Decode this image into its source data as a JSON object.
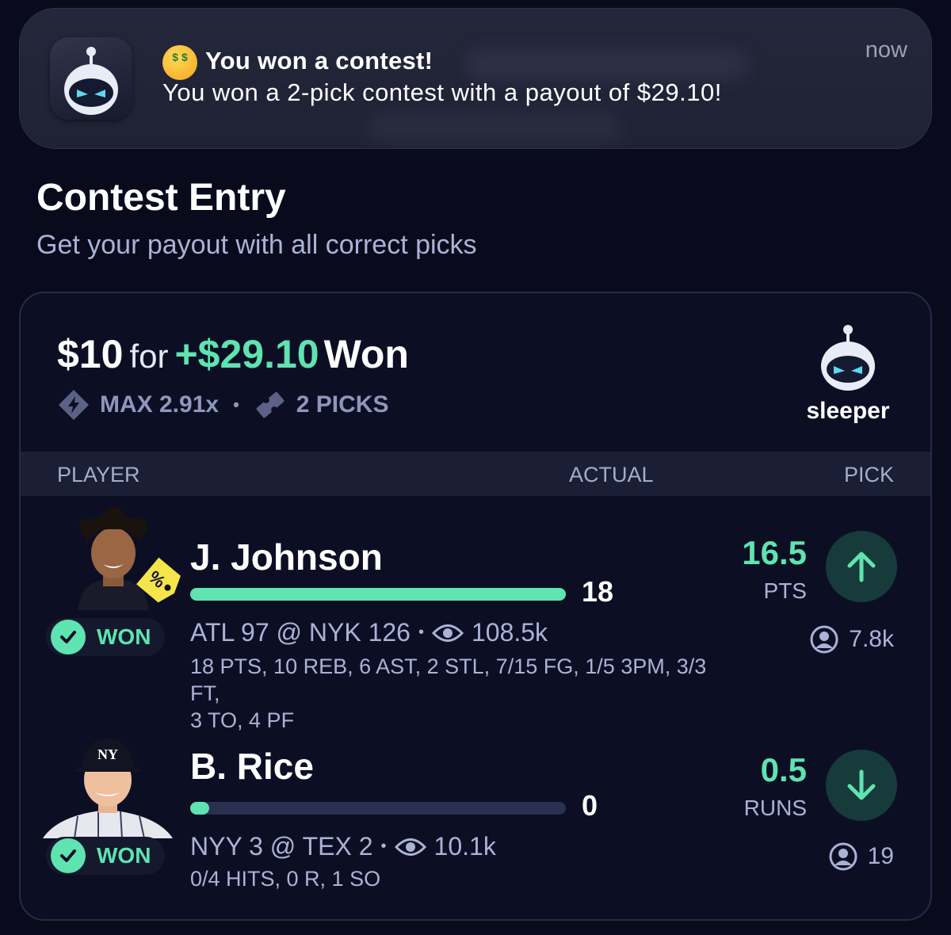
{
  "notification": {
    "title": "You won a contest!",
    "body": "You won a 2-pick contest with a payout of $29.10!",
    "time": "now"
  },
  "header": {
    "title": "Contest Entry",
    "subtitle": "Get your payout with all correct picks"
  },
  "entry": {
    "stake": "$10",
    "for_text": "for",
    "payout": "+$29.10",
    "result": "Won",
    "max_multiplier": "MAX 2.91x",
    "picks_count": "2 PICKS",
    "brand": "sleeper"
  },
  "table": {
    "columns": [
      "PLAYER",
      "ACTUAL",
      "PICK"
    ]
  },
  "picks": [
    {
      "player": "J. Johnson",
      "status": "WON",
      "actual": "18",
      "progress": 1.0,
      "game": "ATL 97 @ NYK 126",
      "watchers": "108.5k",
      "stats_line1": "18 PTS, 10 REB, 6 AST, 2 STL, 7/15 FG, 1/5 3PM, 3/3 FT,",
      "stats_line2": "3 TO, 4 PF",
      "line": "16.5",
      "unit": "PTS",
      "direction": "up",
      "pickers": "7.8k",
      "badge_icon": "discount-tag-icon"
    },
    {
      "player": "B. Rice",
      "status": "WON",
      "actual": "0",
      "progress": 0.05,
      "game": "NYY 3 @ TEX 2",
      "watchers": "10.1k",
      "stats_line1": "0/4 HITS, 0 R, 1 SO",
      "stats_line2": "",
      "line": "0.5",
      "unit": "RUNS",
      "direction": "down",
      "pickers": "19"
    }
  ],
  "colors": {
    "background": "#090b1d",
    "accent": "#5fe3b0",
    "muted": "#aab2d6"
  }
}
